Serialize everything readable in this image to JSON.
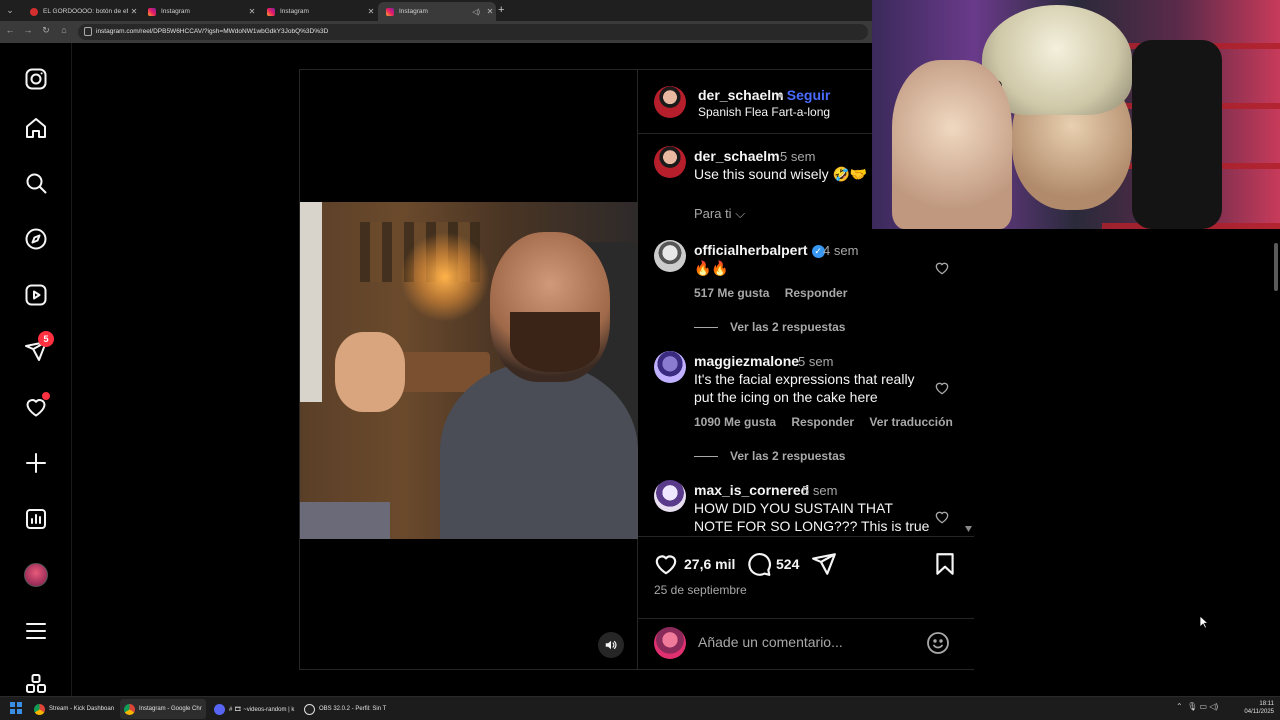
{
  "browser": {
    "tabs": [
      {
        "title": "EL GORDOOOO: botón de efec",
        "icon": "red-dot"
      },
      {
        "title": "Instagram",
        "icon": "instagram"
      },
      {
        "title": "Instagram",
        "icon": "instagram"
      },
      {
        "title": "Instagram",
        "icon": "instagram",
        "active": true
      }
    ],
    "url": "instagram.com/reel/DPB5W6HCCAV/?igsh=MWdoNW1wbGdkY3JobQ%3D%3D"
  },
  "sidebar": {
    "items": [
      "instagram-logo-icon",
      "home-icon",
      "search-icon",
      "explore-icon",
      "reels-icon",
      "messages-icon",
      "notifications-icon",
      "create-icon",
      "dashboard-icon",
      "profile-avatar",
      "menu-icon",
      "more-apps-icon"
    ],
    "messages_badge": "5"
  },
  "post": {
    "author": "der_schaelm",
    "follow_label": "Seguir",
    "audio": "Spanish Flea Fart-a-long",
    "caption_time": "5 sem",
    "caption_text": "Use this sound wisely 🤣🤝",
    "filter_label": "Para ti",
    "likes": "27,6 mil",
    "comments_count": "524",
    "date": "25 de septiembre",
    "add_comment_placeholder": "Añade un comentario..."
  },
  "comments": [
    {
      "user": "officialherbalpert",
      "verified": true,
      "time": "4 sem",
      "text": "🔥🔥",
      "likes": "517 Me gusta",
      "reply": "Responder",
      "translate": "",
      "view_replies": "Ver las 2 respuestas"
    },
    {
      "user": "maggiezmalone",
      "verified": false,
      "time": "5 sem",
      "text": "It's the facial expressions that really put the icing on the cake here",
      "likes": "1090 Me gusta",
      "reply": "Responder",
      "translate": "Ver traducción",
      "view_replies": "Ver las 2 respuestas"
    },
    {
      "user": "max_is_cornered",
      "verified": false,
      "time": "5 sem",
      "text": "HOW DID YOU SUSTAIN THAT NOTE FOR SO LONG??? This is true talent",
      "likes": "",
      "reply": "",
      "translate": "",
      "view_replies": ""
    }
  ],
  "taskbar": {
    "apps": [
      {
        "label": "Stream - Kick Dashboan",
        "icon": "chrome"
      },
      {
        "label": "Instagram - Google Chr",
        "icon": "chrome",
        "active": true
      },
      {
        "label": "# 🎞 ~videos-random | k",
        "icon": "discord"
      },
      {
        "label": "OBS 32.0.2 - Perfil: Sin T",
        "icon": "obs"
      }
    ],
    "time": "18:11",
    "date": "04/11/2025"
  },
  "colors": {
    "background": "#000000",
    "follow_blue": "#4a6bff",
    "notification_red": "#ff3040",
    "muted_text": "#a8a8a8",
    "border": "#262626"
  }
}
